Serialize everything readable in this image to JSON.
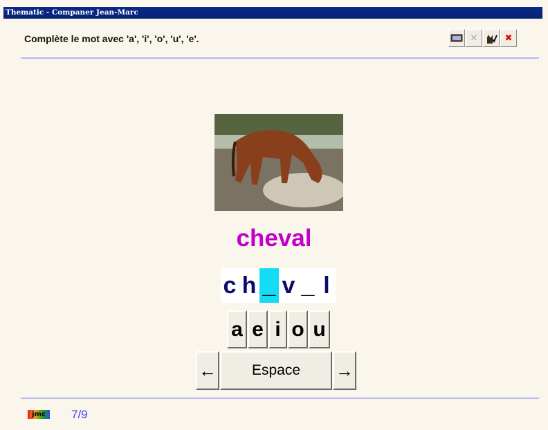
{
  "window": {
    "title": "Thematic - Companer Jean-Marc"
  },
  "instruction": "Complète le mot avec 'a', 'i', 'o', 'u', 'e'.",
  "toolbar": {
    "buttons": [
      {
        "icon": "notebook-icon"
      },
      {
        "icon": "close-x-icon",
        "label": "✕"
      },
      {
        "icon": "cat-check-icon"
      },
      {
        "icon": "red-cross-icon",
        "label": "✖"
      }
    ]
  },
  "exercise": {
    "target_word": "cheval",
    "puzzle": [
      {
        "char": "c",
        "blank": false,
        "active": false
      },
      {
        "char": "h",
        "blank": false,
        "active": false
      },
      {
        "char": "_",
        "blank": true,
        "active": true
      },
      {
        "char": "v",
        "blank": false,
        "active": false
      },
      {
        "char": "_",
        "blank": true,
        "active": false
      },
      {
        "char": "l",
        "blank": false,
        "active": false
      }
    ],
    "letters": [
      "a",
      "e",
      "i",
      "o",
      "u"
    ],
    "nav": {
      "left": "←",
      "space": "Espace",
      "right": "→"
    }
  },
  "footer": {
    "logo": "jmc",
    "progress": "7/9"
  },
  "colors": {
    "title_bar": "#0a2a8c",
    "word": "#c000c8",
    "active_cell": "#15dcf5",
    "divider": "#b7b9f0",
    "progress": "#4040ff"
  }
}
